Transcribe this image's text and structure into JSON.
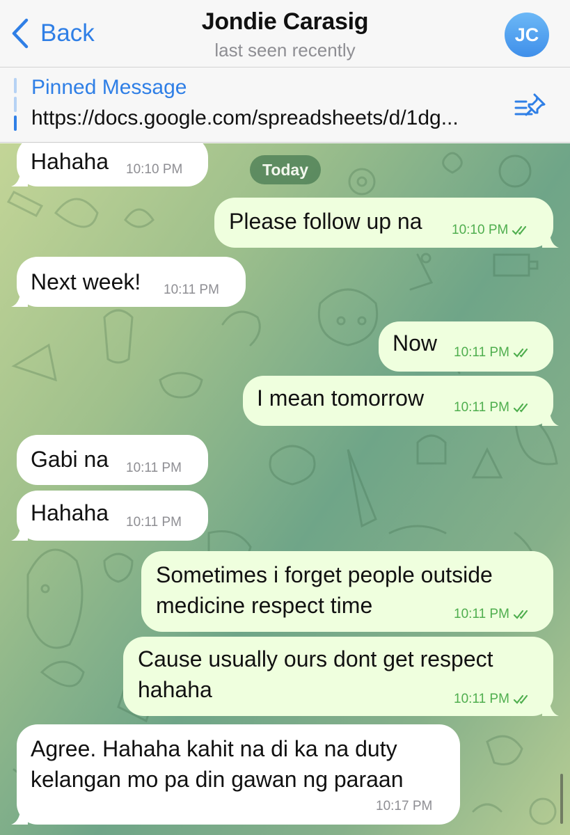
{
  "header": {
    "back_label": "Back",
    "title": "Jondie Carasig",
    "subtitle": "last seen recently",
    "avatar_initials": "JC",
    "accent_color": "#2f7fe6"
  },
  "pinned": {
    "label": "Pinned Message",
    "text": "https://docs.google.com/spreadsheets/d/1dg..."
  },
  "chat": {
    "date_separator": "Today",
    "messages": [
      {
        "direction": "incoming",
        "text": "Hahaha",
        "time": "10:10 PM"
      },
      {
        "direction": "outgoing",
        "text": "Please follow up na",
        "time": "10:10 PM",
        "status": "read"
      },
      {
        "direction": "incoming",
        "text": "Next week!",
        "time": "10:11 PM"
      },
      {
        "direction": "outgoing",
        "text": "Now",
        "time": "10:11 PM",
        "status": "read"
      },
      {
        "direction": "outgoing",
        "text": "I mean tomorrow",
        "time": "10:11 PM",
        "status": "read"
      },
      {
        "direction": "incoming",
        "text": "Gabi na",
        "time": "10:11 PM"
      },
      {
        "direction": "incoming",
        "text": "Hahaha",
        "time": "10:11 PM"
      },
      {
        "direction": "outgoing",
        "lines": [
          "Sometimes i forget people outside",
          "medicine respect time"
        ],
        "time": "10:11 PM",
        "status": "read"
      },
      {
        "direction": "outgoing",
        "lines": [
          "Cause usually ours dont get respect",
          "hahaha"
        ],
        "time": "10:11 PM",
        "status": "read"
      },
      {
        "direction": "incoming",
        "lines": [
          "Agree. Hahaha kahit na di ka na duty",
          "kelangan mo pa din gawan ng paraan"
        ],
        "time": "10:17 PM"
      }
    ]
  },
  "colors": {
    "incoming_bubble": "#ffffff",
    "outgoing_bubble": "#efffde",
    "outgoing_time": "#4fae4e"
  }
}
